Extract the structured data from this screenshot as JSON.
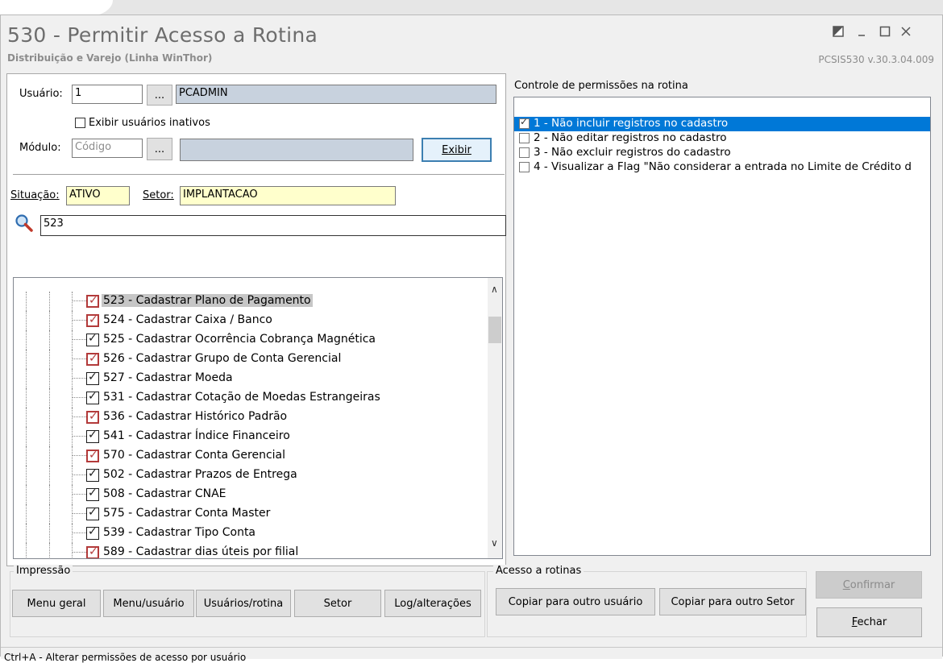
{
  "window": {
    "title": "530 - Permitir Acesso a Rotina",
    "subtitle": "Distribuição e Varejo (Linha WinThor)",
    "version": "PCSIS530  v.30.3.04.009"
  },
  "form": {
    "usuario_label": "Usuário:",
    "usuario_code": "1",
    "browse_label": "...",
    "usuario_name": "PCADMIN",
    "inactive_label": "Exibir usuários inativos",
    "modulo_label": "Módulo:",
    "modulo_placeholder": "Código",
    "exibir_label": "Exibir",
    "situacao_label": "Situação:",
    "situacao_value": "ATIVO",
    "setor_label": "Setor:",
    "setor_value": "IMPLANTACAO",
    "search_value": "523"
  },
  "tree": {
    "items": [
      {
        "label": "523 - Cadastrar Plano de Pagamento",
        "style": "red",
        "selected": true
      },
      {
        "label": "524 - Cadastrar Caixa / Banco",
        "style": "red",
        "selected": false
      },
      {
        "label": "525 - Cadastrar Ocorrência Cobrança Magnética",
        "style": "black",
        "selected": false
      },
      {
        "label": "526 - Cadastrar Grupo de Conta Gerencial",
        "style": "red",
        "selected": false
      },
      {
        "label": "527 - Cadastrar Moeda",
        "style": "black",
        "selected": false
      },
      {
        "label": "531 - Cadastrar Cotação de Moedas Estrangeiras",
        "style": "black",
        "selected": false
      },
      {
        "label": "536 - Cadastrar Histórico Padrão",
        "style": "red",
        "selected": false
      },
      {
        "label": "541 - Cadastrar Índice Financeiro",
        "style": "black",
        "selected": false
      },
      {
        "label": "570 - Cadastrar Conta Gerencial",
        "style": "red",
        "selected": false
      },
      {
        "label": "502 - Cadastrar Prazos de Entrega",
        "style": "black",
        "selected": false
      },
      {
        "label": "508 - Cadastrar CNAE",
        "style": "black",
        "selected": false
      },
      {
        "label": "575 - Cadastrar Conta Master",
        "style": "black",
        "selected": false
      },
      {
        "label": "539 - Cadastrar Tipo Conta",
        "style": "black",
        "selected": false
      },
      {
        "label": "589 - Cadastrar dias úteis por filial",
        "style": "red",
        "selected": false
      }
    ]
  },
  "permissions": {
    "title": "Controle de permissões na rotina",
    "items": [
      {
        "label": "1 - Não incluir registros no cadastro",
        "checked": true,
        "selected": true
      },
      {
        "label": "2 - Não editar registros no cadastro",
        "checked": false,
        "selected": false
      },
      {
        "label": "3 - Não excluir registros do cadastro",
        "checked": false,
        "selected": false
      },
      {
        "label": "4 - Visualizar a Flag \"Não considerar a entrada no Limite de Crédito d",
        "checked": false,
        "selected": false
      }
    ]
  },
  "impressao": {
    "label": "Impressão",
    "buttons": [
      "Menu geral",
      "Menu/usuário",
      "Usuários/rotina",
      "Setor",
      "Log/alterações"
    ]
  },
  "acesso": {
    "label": "Acesso a rotinas",
    "buttons": [
      "Copiar para outro usuário",
      "Copiar para outro Setor"
    ]
  },
  "actions": {
    "confirmar": "Confirmar",
    "fechar": "Fechar"
  },
  "status": {
    "text": "Ctrl+A - Alterar permissões de acesso por usuário"
  },
  "colors": {
    "selection": "#0078d7",
    "readonly_field": "#ffffcc",
    "lookup_field": "#c8d2de",
    "checkbox_red": "#b33a3a"
  }
}
